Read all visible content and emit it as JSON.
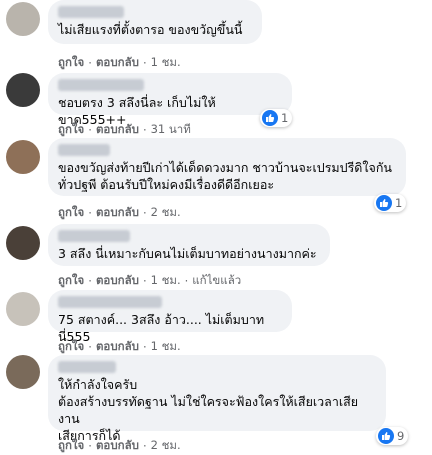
{
  "colors": {
    "bubble": "#f0f2f5",
    "action_text": "#65676b",
    "like_blue": "#1877f2"
  },
  "comments": [
    {
      "text": "ไม่เสียแรงที่ตั้งตารอ ของขวัญขึ้นนี้",
      "like_label": "ถูกใจ",
      "reply_label": "ตอบกลับ",
      "time": "1 ชม.",
      "reaction_count": null
    },
    {
      "text": "ชอบตรง 3 สลึงนี่ละ เก็บไม่ให้ขาด555++",
      "like_label": "ถูกใจ",
      "reply_label": "ตอบกลับ",
      "time": "31 นาที",
      "reaction_count": "1"
    },
    {
      "text": "ของขวัญส่งท้ายปีเก่าได้เด็ดดวงมาก ชาวบ้านจะเปรมปรีดิใจกัน\nทั่วปฐพี ต้อนรับปีใหม่คงมีเรื่องดีดีอีกเยอะ",
      "like_label": "ถูกใจ",
      "reply_label": "ตอบกลับ",
      "time": "2 ชม.",
      "reaction_count": "1"
    },
    {
      "text": "3 สลึง นี่เหมาะกับคนไม่เต็มบาทอย่างนางมากค่ะ",
      "like_label": "ถูกใจ",
      "reply_label": "ตอบกลับ",
      "time": "1 ชม.",
      "edited": "แก้ไขแล้ว",
      "reaction_count": null
    },
    {
      "text": "75 สตางค์... 3สลึง อ้าว.... ไม่เต็มบาทนี่555",
      "like_label": "ถูกใจ",
      "reply_label": "ตอบกลับ",
      "time": "1 ชม.",
      "reaction_count": null
    },
    {
      "text": "ให้กำลังใจครับ\nต้องสร้างบรรทัดฐาน ไม่ใช่ใครจะฟ้องใครให้เสียเวลาเสียงาน\nเสียการก็ได้",
      "like_label": "ถูกใจ",
      "reply_label": "ตอบกลับ",
      "time": "2 ชม.",
      "reaction_count": "9"
    }
  ]
}
